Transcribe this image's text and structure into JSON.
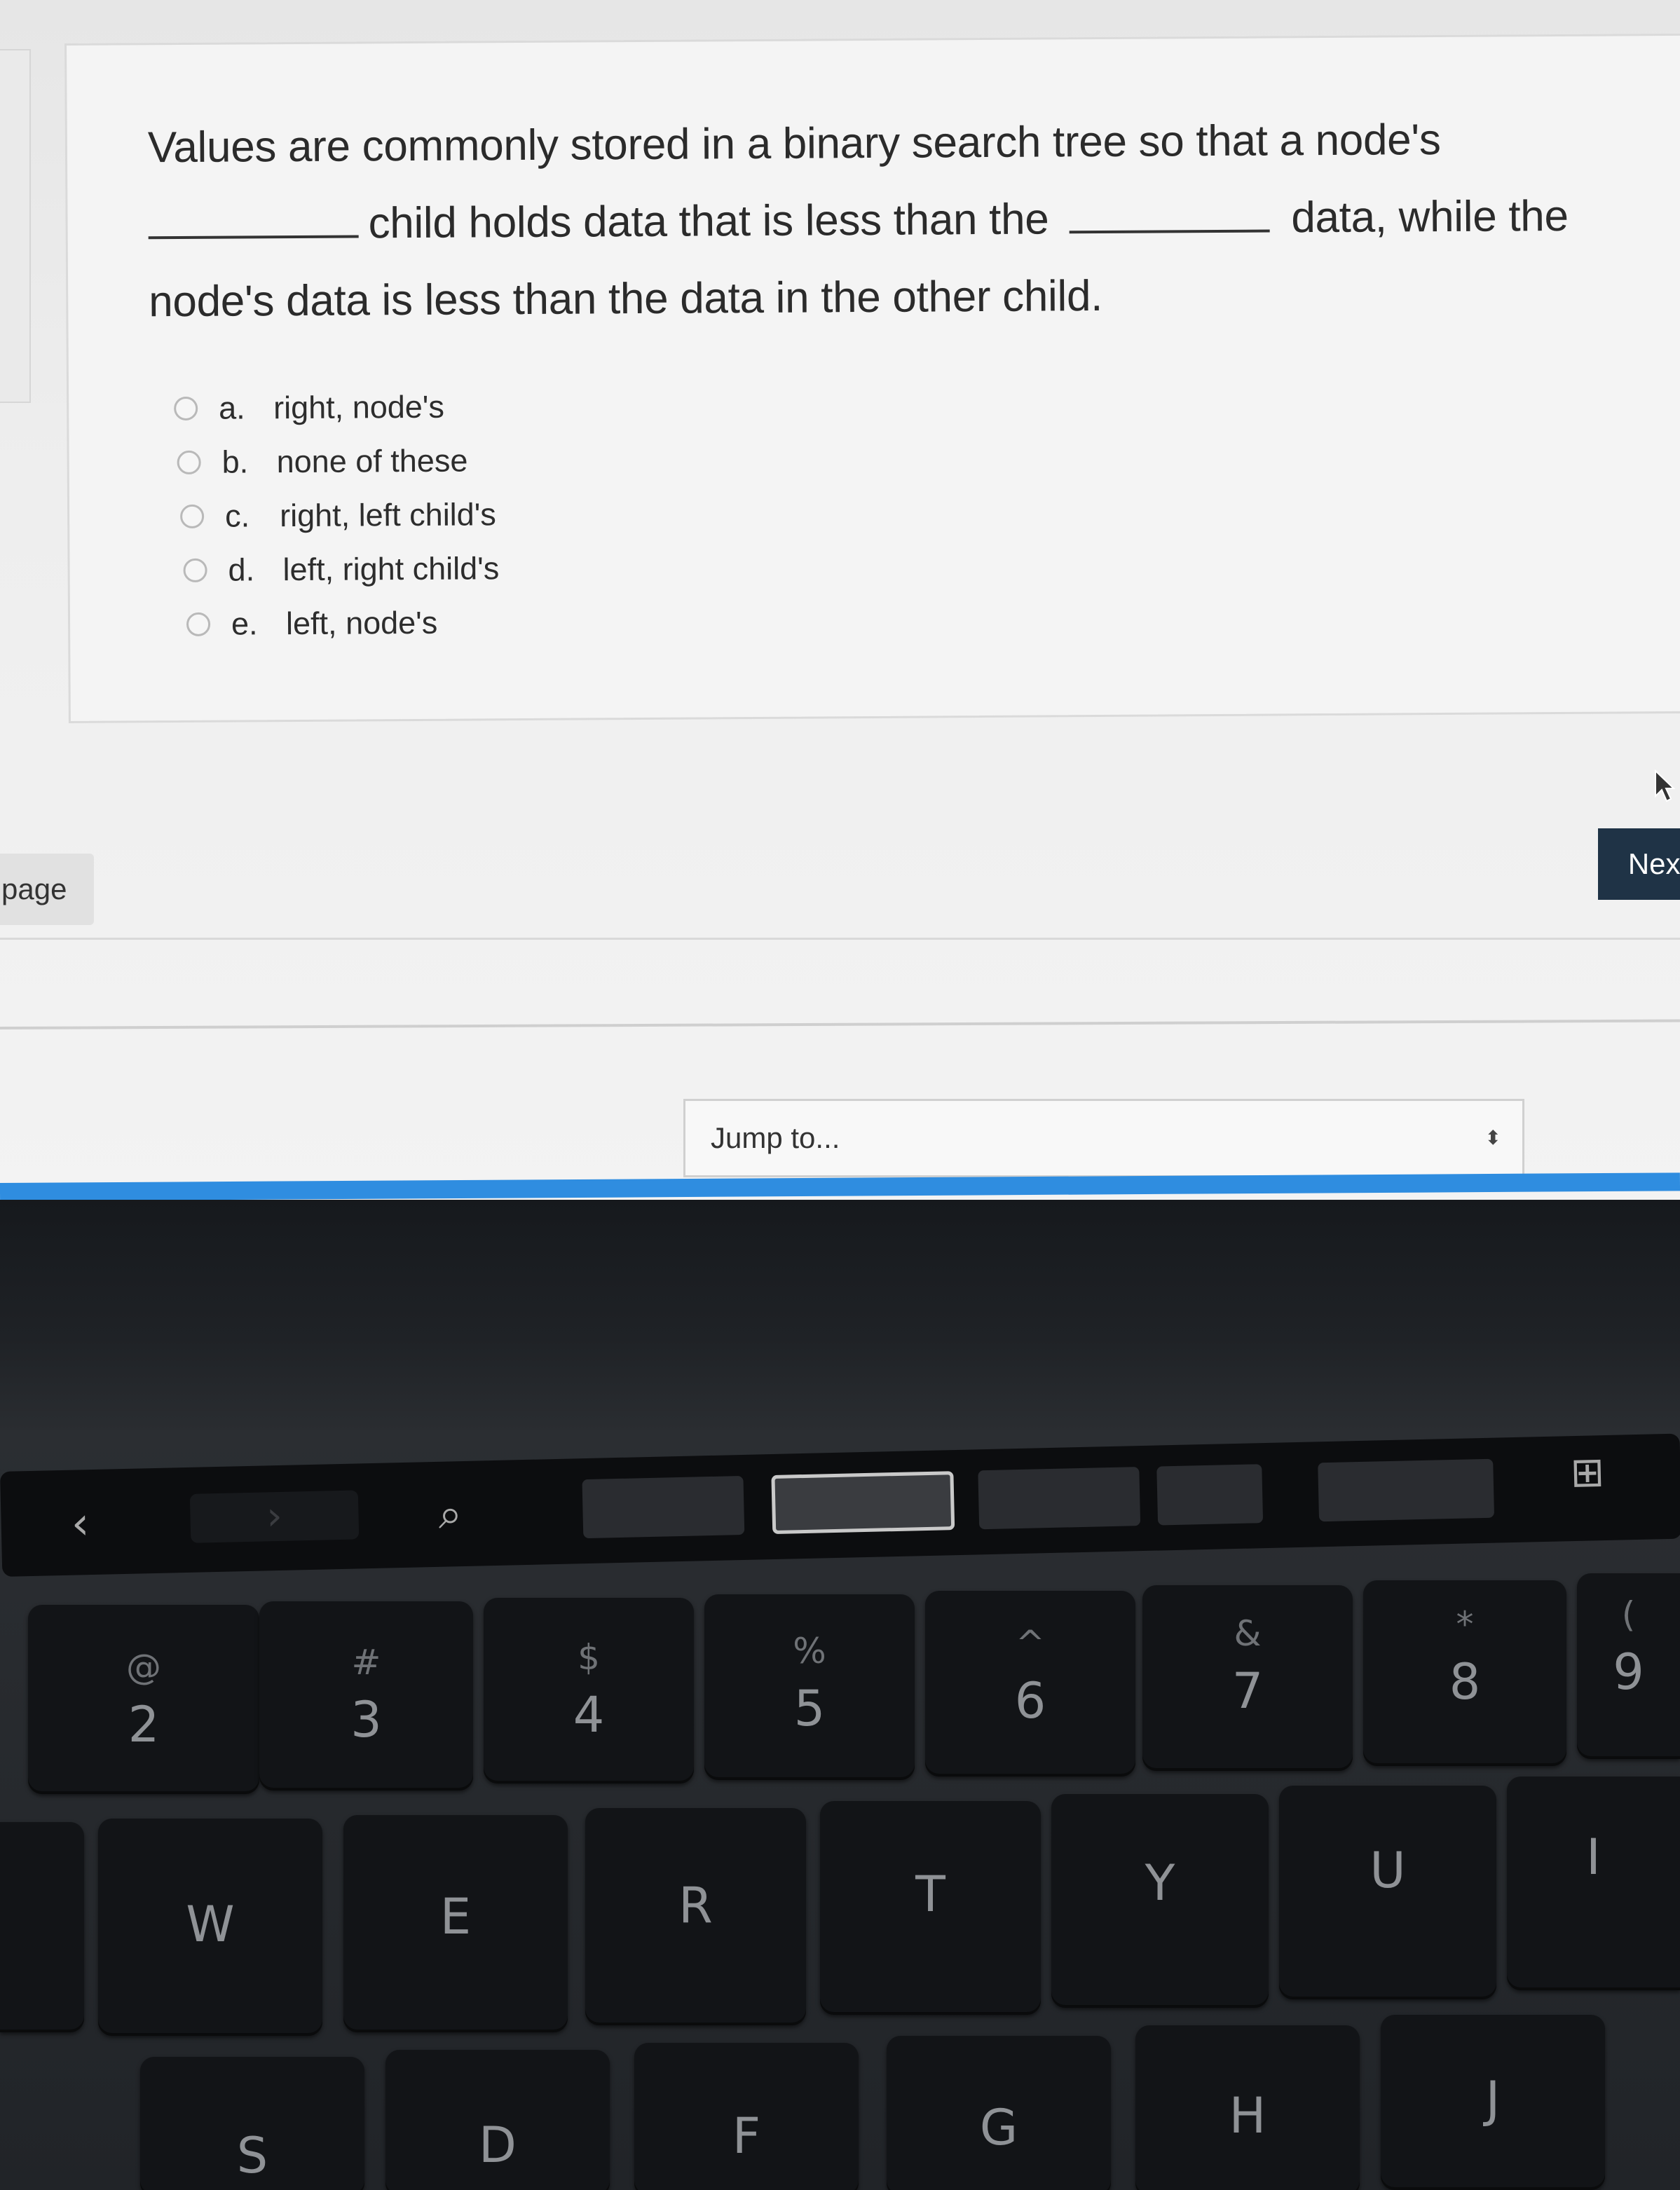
{
  "question": {
    "part1": "Values are commonly stored in a binary search tree so that a node's",
    "part2": "child holds data that is less than the",
    "part3": "data, while the",
    "part4": "node's data is less than the data in the other child."
  },
  "options": [
    {
      "letter": "a.",
      "text": "right, node's"
    },
    {
      "letter": "b.",
      "text": "none of these"
    },
    {
      "letter": "c.",
      "text": "right, left child's"
    },
    {
      "letter": "d.",
      "text": "left, right child's"
    },
    {
      "letter": "e.",
      "text": "left, node's"
    }
  ],
  "nav": {
    "prev_label": "page",
    "next_label": "Next"
  },
  "jump": {
    "label": "Jump to...",
    "arrows": "⬍"
  },
  "touchbar": {
    "back_icon": "‹",
    "forward_icon": "›",
    "search_icon": "⌕",
    "new_tab_icon": "⊞"
  },
  "keys": {
    "row1": [
      {
        "shift": "@",
        "main": "2"
      },
      {
        "shift": "#",
        "main": "3"
      },
      {
        "shift": "$",
        "main": "4"
      },
      {
        "shift": "%",
        "main": "5"
      },
      {
        "shift": "^",
        "main": "6"
      },
      {
        "shift": "&",
        "main": "7"
      },
      {
        "shift": "*",
        "main": "8"
      },
      {
        "shift": "(",
        "main": "9"
      }
    ],
    "row2": [
      "W",
      "E",
      "R",
      "T",
      "Y",
      "U",
      "I"
    ],
    "row3": [
      "S",
      "D",
      "F",
      "G",
      "H",
      "J"
    ]
  },
  "colors": {
    "next_button": "#1f3346",
    "accent_bar": "#2f8de0"
  }
}
